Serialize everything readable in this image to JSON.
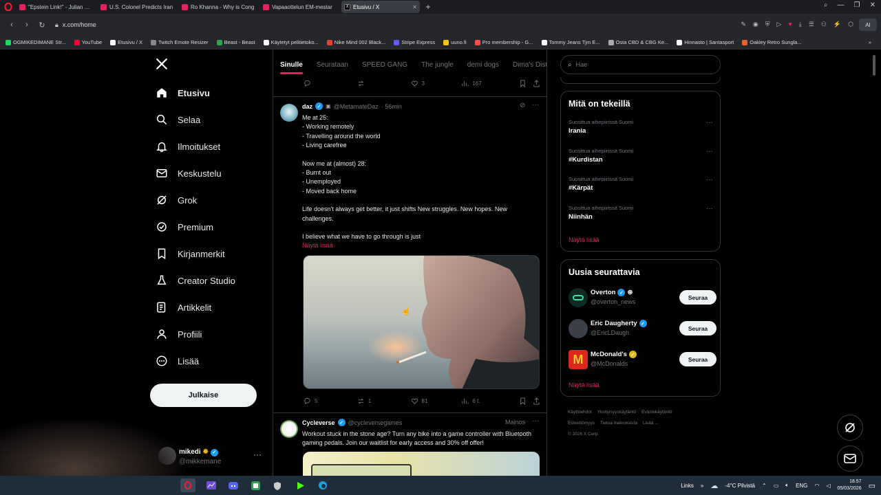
{
  "browser": {
    "tabs": [
      {
        "title": "\"Epstein Link!\" - Julian UNI",
        "active": false,
        "favicon": "youtube-icon"
      },
      {
        "title": "U.S. Colonel Predicts Iran",
        "active": false,
        "favicon": "youtube-icon"
      },
      {
        "title": "Ro Khanna - Why is Cong",
        "active": false,
        "favicon": "youtube-icon"
      },
      {
        "title": "Vapaaottelun EM-mestar",
        "active": false,
        "favicon": "youtube-icon"
      },
      {
        "title": "Etusivu / X",
        "active": true,
        "favicon": "x-icon"
      }
    ],
    "new_tab": "+",
    "url": "x.com/home",
    "ai_label": "AI",
    "bookmarks": [
      {
        "label": "OGMIKEDIMANE Str...",
        "color": "#1ed760"
      },
      {
        "label": "YouTube",
        "color": "#ff0033"
      },
      {
        "label": "Etusivu / X",
        "color": "#ffffff"
      },
      {
        "label": "Twitch Emote Resizer",
        "color": "#888888"
      },
      {
        "label": "Beast - Beast",
        "color": "#2ea44f"
      },
      {
        "label": "Käytetyt pelitietoko...",
        "color": "#ffffff"
      },
      {
        "label": "Nike Mind 002 Black...",
        "color": "#e34234"
      },
      {
        "label": "Stripe Express",
        "color": "#635bff"
      },
      {
        "label": "uuno.fi",
        "color": "#f5c518"
      },
      {
        "label": "Pro membership - G...",
        "color": "#ff4d4d"
      },
      {
        "label": "Tommy Jeans Tjm E...",
        "color": "#ffffff"
      },
      {
        "label": "Osta CBD & CBG Ke...",
        "color": "#aaaaaa"
      },
      {
        "label": "Hinnasto | Santasport",
        "color": "#ffffff"
      },
      {
        "label": "Oakley Retro Sungla...",
        "color": "#e8642a"
      }
    ]
  },
  "sidebar": {
    "items": [
      {
        "label": "Etusivu",
        "icon": "home-icon",
        "active": true
      },
      {
        "label": "Selaa",
        "icon": "search-icon"
      },
      {
        "label": "Ilmoitukset",
        "icon": "bell-icon"
      },
      {
        "label": "Keskustelu",
        "icon": "mail-icon"
      },
      {
        "label": "Grok",
        "icon": "grok-icon"
      },
      {
        "label": "Premium",
        "icon": "x-premium-icon"
      },
      {
        "label": "Kirjanmerkit",
        "icon": "bookmark-icon"
      },
      {
        "label": "Creator Studio",
        "icon": "flask-icon"
      },
      {
        "label": "Artikkelit",
        "icon": "article-icon"
      },
      {
        "label": "Profiili",
        "icon": "person-icon"
      },
      {
        "label": "Lisää",
        "icon": "more-circle-icon"
      }
    ],
    "post_button": "Julkaise",
    "account": {
      "name": "mikedi",
      "handle": "@mikkemane",
      "more": "···"
    }
  },
  "feed": {
    "tabs": [
      "Sinulle",
      "Seurataan",
      "SPEED GANG",
      "The jungle",
      "demi dogs",
      "Dima's Dist"
    ],
    "prev_actions": {
      "replies": "",
      "reposts": "",
      "likes": "3",
      "views": "167"
    },
    "post1": {
      "name": "daz",
      "handle": "@MetamateDaz",
      "time": "· 56min",
      "lines": [
        "Me at 25:",
        "- Working remotely",
        "- Travelling around the world",
        "- Living carefree",
        "",
        "Now me at (almost) 28:",
        "- Burnt out",
        "- Unemployed",
        "- Moved back home",
        "",
        "Life doesn't always get better, it just shifts New struggles. New hopes. New",
        "challenges.",
        "",
        "I believe what we have to go through is just"
      ],
      "show_more": "Näytä lisää",
      "actions": {
        "replies": "5",
        "reposts": "1",
        "likes": "81",
        "views": "6 t."
      }
    },
    "post2": {
      "name": "Cycleverse",
      "handle": "@cycleversegames",
      "ad_label": "Mainos",
      "text": "Workout stuck in the stone age? Turn any bike into a game controller with Bluetooth gaming pedals. Join our waitlist for early access and 30% off offer!"
    }
  },
  "right": {
    "search_placeholder": "Hae",
    "trends_title": "Mitä on tekeillä",
    "trends": [
      {
        "context": "Suosittua aihepiirissä Suomi",
        "name": "Irania"
      },
      {
        "context": "Suosittua aihepiirissä Suomi",
        "name": "#Kurdistan"
      },
      {
        "context": "Suosittua aihepiirissä Suomi",
        "name": "#Kärpät"
      },
      {
        "context": "Suosittua aihepiirissä Suomi",
        "name": "Niinhän"
      }
    ],
    "show_more": "Näytä lisää",
    "wtf_title": "Uusia seurattavia",
    "wtf": [
      {
        "name": "Overton",
        "handle": "@overton_news",
        "follow": "Seuraa",
        "avatar_color": "#0d2b24"
      },
      {
        "name": "Eric Daugherty",
        "handle": "@EricLDaugh",
        "follow": "Seuraa",
        "avatar_color": "#3b3f47"
      },
      {
        "name": "McDonald's",
        "handle": "@McDonalds",
        "follow": "Seuraa",
        "avatar_color": "#da291c"
      }
    ],
    "footer": [
      "Käyttöehdot",
      "Yksityisyyskäytäntö",
      "Evästekäytäntö",
      "Esteettömyys",
      "Tietoa mainoksista",
      "Lisää ...",
      "© 2026 X Corp."
    ]
  },
  "taskbar": {
    "links": "Links",
    "weather": "-4°C  Pilvistä",
    "lang": "ENG",
    "time": "18.57",
    "date": "05/03/2026"
  },
  "colors": {
    "accent": "#e0245e",
    "verified": "#1d9bf0",
    "gold": "#e2b719"
  }
}
